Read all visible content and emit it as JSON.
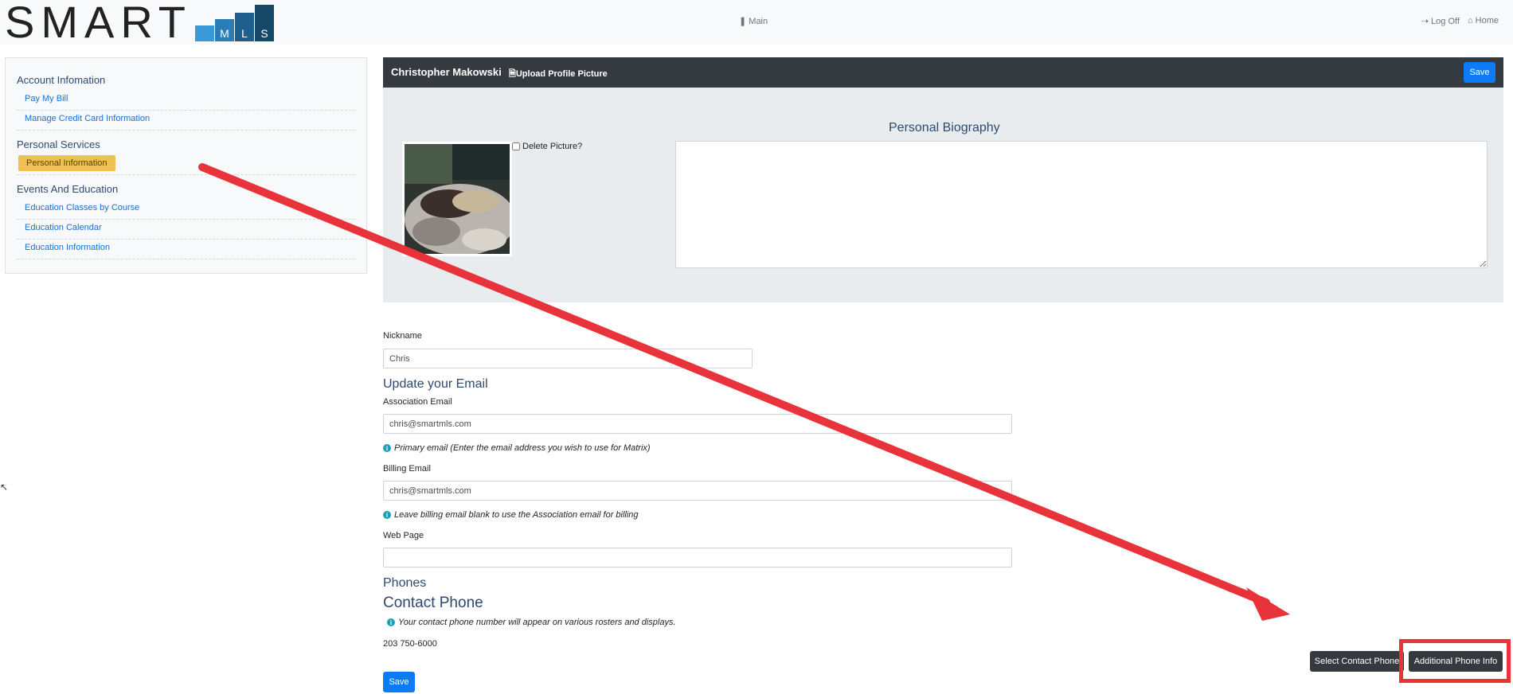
{
  "header": {
    "logo_text": "SMART",
    "logo_letters": [
      "M",
      "L",
      "S"
    ],
    "nav_main": "Main",
    "nav_logoff": "Log Off",
    "nav_home": "Home"
  },
  "sidebar": {
    "sections": [
      {
        "title": "Account Infomation",
        "items": [
          "Pay My Bill",
          "Manage Credit Card Information"
        ]
      },
      {
        "title": "Personal Services",
        "items": [
          "Personal Information"
        ]
      },
      {
        "title": "Events And Education",
        "items": [
          "Education Classes by Course",
          "Education Calendar",
          "Education Information"
        ]
      }
    ]
  },
  "profile": {
    "name": "Christopher Makowski",
    "upload_label": "Upload Profile Picture",
    "save_label": "Save",
    "delete_label": "Delete Picture?",
    "bio_title": "Personal Biography",
    "bio_value": ""
  },
  "form": {
    "nickname_label": "Nickname",
    "nickname_value": "Chris",
    "email_heading": "Update your Email",
    "assoc_email_label": "Association Email",
    "assoc_email_value": "chris@smartmls.com",
    "assoc_email_hint": "Primary email (Enter the email address you wish to use for Matrix)",
    "billing_email_label": "Billing Email",
    "billing_email_value": "chris@smartmls.com",
    "billing_email_hint": "Leave billing email blank to use the Association email for billing",
    "webpage_label": "Web Page",
    "webpage_value": "",
    "phones_heading": "Phones",
    "contact_phone_heading": "Contact Phone",
    "contact_phone_hint": "Your contact phone number will appear on various rosters and displays.",
    "contact_phone_value": "203 750-6000",
    "select_contact_phone_label": "Select Contact Phone",
    "additional_phone_label": "Additional Phone Info",
    "save_label": "Save"
  },
  "colors": {
    "annotation_arrow": "#e8333b",
    "primary_button": "#0d7bf7",
    "active_sidebar": "#f0c050"
  }
}
